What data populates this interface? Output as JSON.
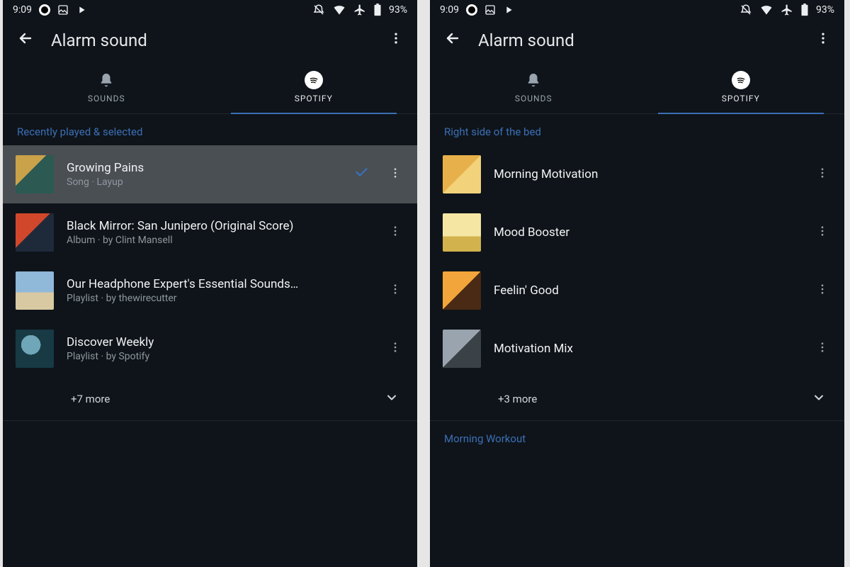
{
  "status": {
    "time": "9:09",
    "battery": "93%"
  },
  "header": {
    "title": "Alarm sound"
  },
  "tabs": {
    "sounds": "SOUNDS",
    "spotify": "SPOTIFY"
  },
  "left": {
    "section": "Recently played & selected",
    "items": [
      {
        "title": "Growing Pains",
        "sub": "Song · Layup",
        "selected": true
      },
      {
        "title": "Black Mirror: San Junipero (Original Score)",
        "sub": "Album · by Clint Mansell",
        "selected": false
      },
      {
        "title": "Our Headphone Expert's Essential Sounds…",
        "sub": "Playlist · by thewirecutter",
        "selected": false
      },
      {
        "title": "Discover Weekly",
        "sub": "Playlist · by Spotify",
        "selected": false
      }
    ],
    "more": "+7 more"
  },
  "right": {
    "section": "Right side of the bed",
    "items": [
      {
        "title": "Morning Motivation",
        "sub": ""
      },
      {
        "title": "Mood Booster",
        "sub": ""
      },
      {
        "title": "Feelin' Good",
        "sub": ""
      },
      {
        "title": "Motivation Mix",
        "sub": ""
      }
    ],
    "more": "+3 more",
    "section2": "Morning Workout"
  }
}
